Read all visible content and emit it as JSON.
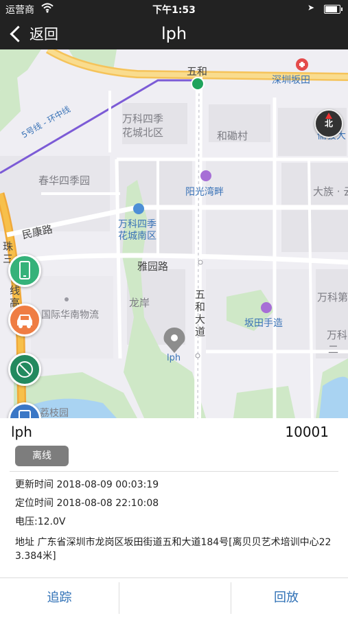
{
  "status_bar": {
    "carrier": "运营商",
    "time": "下午1:53",
    "icons": [
      "wifi-icon",
      "location-arrow-icon",
      "battery-icon"
    ]
  },
  "nav": {
    "back_label": "返回",
    "title": "lph"
  },
  "map": {
    "labels": {
      "wuhe": "五和",
      "shenzhen_bantian": "深圳坂田",
      "vanke_north_1": "万科四季",
      "vanke_north_2": "花城北区",
      "hedihecun": "和磡村",
      "rujun": "儒骏大",
      "metro_line": "5号线 - 环中线",
      "chunhua": "春华四季园",
      "yangguang": "阳光湾畔",
      "dazu": "大族 · 云",
      "vanke_south_1": "万科四季",
      "vanke_south_2": "花城南区",
      "minkang": "民康路",
      "zhu": "珠",
      "san": "三",
      "xian": "线",
      "gao": "高",
      "yayuan": "雅园路",
      "wanke_e": "万科第",
      "longan": "龙岸",
      "wuhe_road_1": "五",
      "wuhe_road_2": "和",
      "wuhe_road_3": "大",
      "wuhe_road_4": "道",
      "guoji": "国际华南物流",
      "bantian_shouzao": "坂田手造",
      "wanke_f": "万科",
      "er": "二",
      "marker": "lph",
      "lizhi": "荔枝园",
      "compass_n": "北"
    },
    "fab_buttons": [
      "phone-icon",
      "car-icon",
      "no-track-icon",
      "document-icon"
    ]
  },
  "device": {
    "name": "lph",
    "id": "10001",
    "status_badge": "离线",
    "update_time": "更新时间 2018-08-09 00:03:19",
    "locate_time": "定位时间 2018-08-08 22:10:08",
    "voltage": "电压:12.0V",
    "address": "地址 广东省深圳市龙岗区坂田街道五和大道184号[离贝贝艺术培训中心223.384米]"
  },
  "actions": {
    "track": "追踪",
    "middle": "",
    "playback": "回放"
  }
}
